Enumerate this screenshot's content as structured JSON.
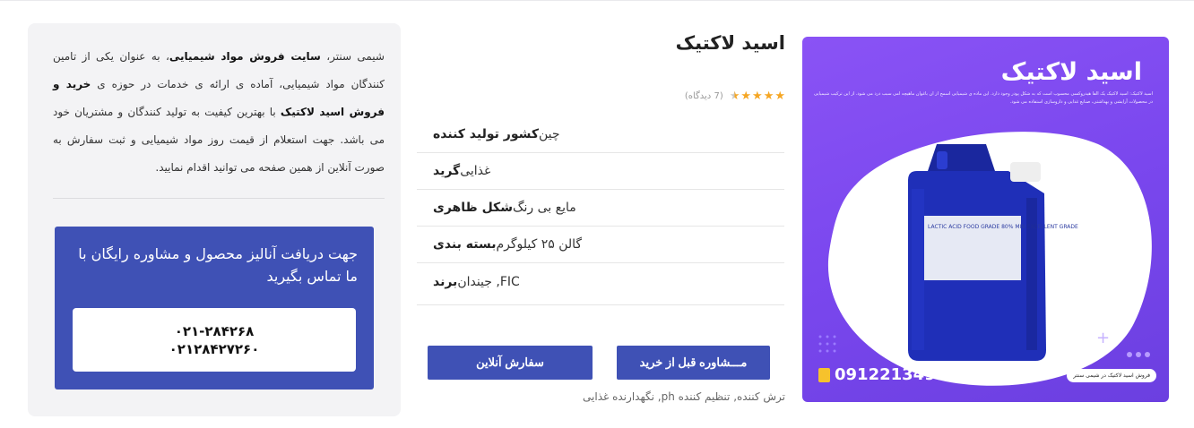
{
  "product": {
    "title": "اسید لاکتیک",
    "rating": 4.5,
    "review_count": "(7 دیدگاه)",
    "specs": [
      {
        "key": "کشور تولید کننده",
        "value": "چین"
      },
      {
        "key": "گرید",
        "value": "غذایی"
      },
      {
        "key": "شکل ظاهری",
        "value": "مایع بی رنگ"
      },
      {
        "key": "بسته بندی",
        "value": "گالن ۲۵ کیلوگرم"
      },
      {
        "key": "برند",
        "value": "FIC, جیندان"
      }
    ],
    "buttons": {
      "consult": "مـــشاوره قبل از خرید",
      "order": "سفارش آنلاین"
    },
    "tags": "ترش کننده, تنظیم کننده ph, نگهدارنده غذایی"
  },
  "image": {
    "title": "اسید لاکتیک",
    "description": "اسید لاکتیک: اسید لاکتیک یک الفا هیدروکسی محسوب است که به شکل پودر وجود دارد. این ماده ی شیمیایی اسمج از ان باغوان ماهیچه امی سبب درد می شود. از این ترکیب شیمیایی در محصولات آرایشی و بهداشتی، صنایع غذایی و داروسازی استفاده می شود.",
    "phone": "09122134999",
    "badge": "فروش اسید لاکتیک در شیمی سنتر",
    "label_text": "LACTIC ACID FOOD GRADE 80% MIN EXCELLENT GRADE"
  },
  "info": {
    "paragraph_parts": [
      "شیمی سنتر، ",
      "سایت فروش مواد شیمیایی",
      "، به عنوان یکی از تامین کنندگان مواد شیمیایی، آماده ی ارائه ی خدمات در حوزه ی ",
      "خرید و فروش اسید لاکتیک",
      " با بهترین کیفیت به تولید کنندگان و مشتریان خود می باشد. جهت استعلام از قیمت روز مواد شیمیایی و ثبت سفارش به صورت آنلاین از همین صفحه می توانید اقدام نمایید."
    ],
    "contact_text": "جهت دریافت آنالیز محصول و مشاوره رایگان با ما تماس بگیرید",
    "phones": [
      "۰۲۱-۲۸۴۲۶۸",
      "۰۲۱۲۸۴۲۷۲۶۰"
    ]
  },
  "colors": {
    "primary": "#3f51b5",
    "image_bg": "#7a47ee",
    "star": "#f5a623",
    "card_bg": "#f3f3f5"
  }
}
